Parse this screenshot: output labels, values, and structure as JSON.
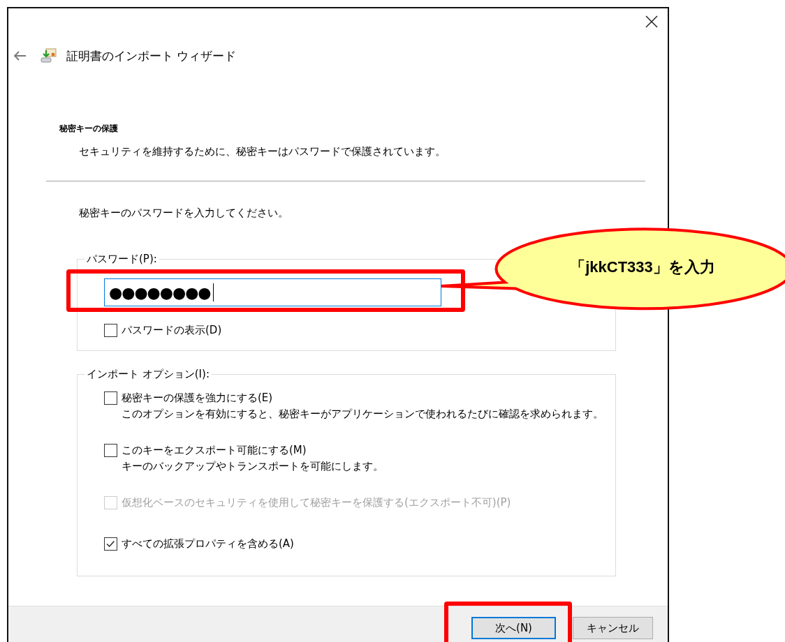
{
  "window": {
    "title": "証明書のインポート ウィザード"
  },
  "section_title": "秘密キーの保護",
  "section_description": "セキュリティを維持するために、秘密キーはパスワードで保護されています。",
  "prompt": "秘密キーのパスワードを入力してください。",
  "password_group": {
    "legend": "パスワード(P):",
    "field": {
      "value": "●●●●●●●●",
      "focused": true
    },
    "show_password": {
      "label": "パスワードの表示(D)",
      "checked": false,
      "disabled": false
    }
  },
  "import_options": {
    "legend": "インポート オプション(I):",
    "options": [
      {
        "label": "秘密キーの保護を強力にする(E)",
        "description": "このオプションを有効にすると、秘密キーがアプリケーションで使われるたびに確認を求められます。",
        "checked": false,
        "disabled": false
      },
      {
        "label": "このキーをエクスポート可能にする(M)",
        "description": "キーのバックアップやトランスポートを可能にします。",
        "checked": false,
        "disabled": false
      },
      {
        "label": "仮想化ベースのセキュリティを使用して秘密キーを保護する(エクスポート不可)(P)",
        "checked": false,
        "disabled": true
      },
      {
        "label": "すべての拡張プロパティを含める(A)",
        "checked": true,
        "disabled": false
      }
    ]
  },
  "buttons": [
    {
      "label": "次へ(N)",
      "default": true
    },
    {
      "label": "キャンセル",
      "default": false
    }
  ],
  "callout": {
    "text": "「jkkCT333」を入力"
  }
}
